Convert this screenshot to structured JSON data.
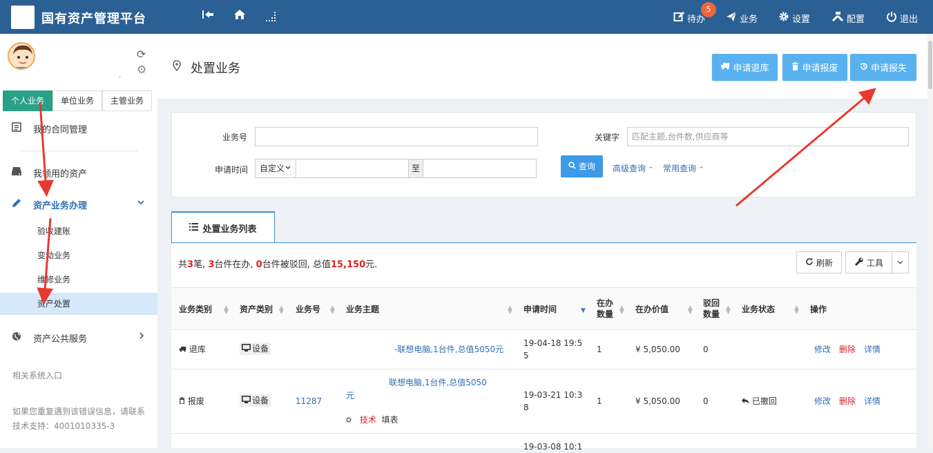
{
  "topbar": {
    "app_title": "国有资产管理平台",
    "todo_label": "待办",
    "todo_count": "5",
    "business_label": "业务",
    "settings_label": "设置",
    "config_label": "配置",
    "logout_label": "退出"
  },
  "sidebar": {
    "tabs": [
      "个人业务",
      "单位业务",
      "主管业务"
    ],
    "items": {
      "contracts": "我的合同管理",
      "my_assets": "我领用的资产",
      "asset_business": "资产业务办理",
      "public_service": "资产公共服务"
    },
    "subitems": [
      "验收建账",
      "变动业务",
      "维修业务",
      "资产处置"
    ],
    "related_entry": "相关系统入口",
    "support_note": "如果您重复遇到该错误信息，请联系技术支持：4001010335-3"
  },
  "page": {
    "title": "处置业务",
    "actions": [
      "申请退库",
      "申请报废",
      "申请报失"
    ]
  },
  "search": {
    "business_no_label": "业务号",
    "keyword_label": "关键字",
    "keyword_placeholder": "匹配主题,台件数,供应商等",
    "apply_time_label": "申请时间",
    "range_select": "自定义",
    "to_label": "至",
    "query_button": "查询",
    "advanced_query": "高级查询",
    "common_query": "常用查询"
  },
  "list": {
    "tab_label": "处置业务列表",
    "summary": {
      "p1": "共",
      "count": "3",
      "p2": "笔, ",
      "in_progress": "3",
      "p3": "台件在办, ",
      "rejected": "0",
      "p4": "台件被驳回, 总值",
      "total": "15,150",
      "p5": "元."
    },
    "refresh_button": "刷新",
    "tools_button": "工具",
    "columns": {
      "type": "业务类别",
      "asset_type": "资产类别",
      "no": "业务号",
      "subject": "业务主题",
      "time": "申请时间",
      "qty_l1": "在办",
      "qty_l2": "数量",
      "value": "在办价值",
      "rej_l1": "驳回",
      "rej_l2": "数量",
      "status": "业务状态",
      "ops": "操作"
    },
    "rows": [
      {
        "type": "退库",
        "asset_type": "设备",
        "no": "",
        "subject": "-联想电脑,1台件,总值5050元",
        "time_l1": "19-04-18 19:5",
        "time_l2": "5",
        "qty": "1",
        "value": "¥ 5,050.00",
        "rejected": "0",
        "status": "",
        "op_edit": "修改",
        "op_delete": "删除",
        "op_detail": "详情"
      },
      {
        "type": "报废",
        "asset_type": "设备",
        "no": "11287",
        "subject_l1": "联想电脑,1台件,总值5050",
        "subject_l2": "元",
        "step_role": "技术",
        "step_action": "填表",
        "time_l1": "19-03-21 10:3",
        "time_l2": "8",
        "qty": "1",
        "value": "¥ 5,050.00",
        "rejected": "0",
        "status": "已撤回",
        "op_edit": "修改",
        "op_delete": "删除",
        "op_detail": "详情"
      },
      {
        "time_l1": "19-03-08 10:1"
      }
    ]
  },
  "colors": {
    "topbar": "#2b6095",
    "tab_active": "#2aa186",
    "action_button": "#5ab1ef",
    "annotation_arrow": "#e8392f"
  }
}
